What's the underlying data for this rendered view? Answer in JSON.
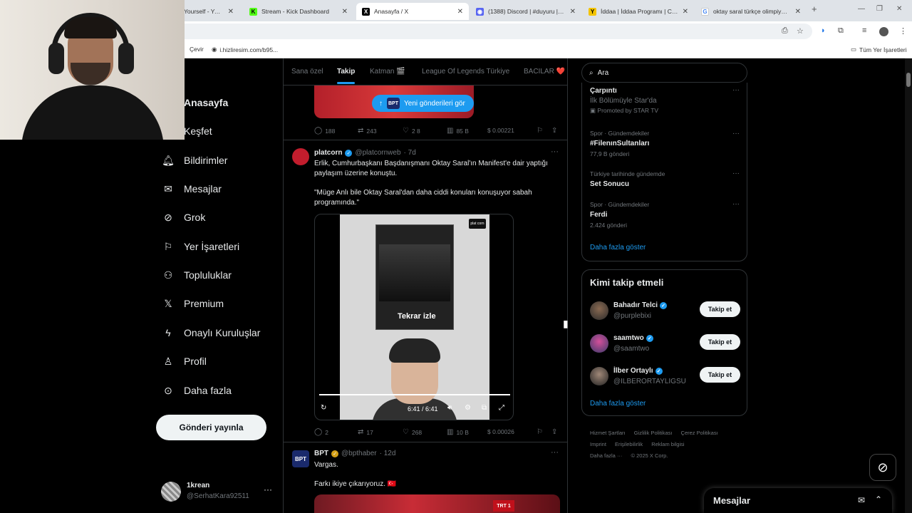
{
  "browser": {
    "tabs": [
      {
        "title": "Yourself - YouTu",
        "icon": "youtube-icon",
        "color": "#ff0000"
      },
      {
        "title": "Stream - Kick Dashboard",
        "icon": "kick-icon",
        "color": "#53fc18"
      },
      {
        "title": "Anasayfa / X",
        "icon": "x-icon",
        "color": "#000000"
      },
      {
        "title": "(1388) Discord | #duyuru | krea",
        "icon": "discord-icon",
        "color": "#5865f2"
      },
      {
        "title": "İddaa | İddaa Programı | Canlı",
        "icon": "iddaa-icon",
        "color": "#f4c400"
      },
      {
        "title": "oktay saral türkçe olimpiyatlan",
        "icon": "google-icon",
        "color": "#4285f4"
      }
    ],
    "bookmarks": {
      "translate": "Çevir",
      "link": "i.hizliresim.com/b95...",
      "all": "Tüm Yer İşaretleri"
    }
  },
  "nav": {
    "items": [
      {
        "label": "Anasayfa",
        "icon": "home-icon"
      },
      {
        "label": "Keşfet",
        "icon": "search-icon"
      },
      {
        "label": "Bildirimler",
        "icon": "bell-icon"
      },
      {
        "label": "Mesajlar",
        "icon": "mail-icon"
      },
      {
        "label": "Grok",
        "icon": "grok-icon"
      },
      {
        "label": "Yer İşaretleri",
        "icon": "bookmark-icon"
      },
      {
        "label": "Topluluklar",
        "icon": "communities-icon"
      },
      {
        "label": "Premium",
        "icon": "x-logo-icon"
      },
      {
        "label": "Onaylı Kuruluşlar",
        "icon": "lightning-icon"
      },
      {
        "label": "Profil",
        "icon": "person-icon"
      },
      {
        "label": "Daha fazla",
        "icon": "more-circle-icon"
      }
    ],
    "post_button": "Gönderi yayınla",
    "account": {
      "name": "1krean",
      "handle": "@SerhatKara92511"
    }
  },
  "feed": {
    "tabs": [
      "Sana özel",
      "Takip",
      "Katman 🎬",
      "League Of Legends Türkiye",
      "BACILAR ❤️"
    ],
    "active_tab": "Takip",
    "new_posts": "Yeni gönderileri gör",
    "new_posts_badge": "BPT",
    "first_actions": {
      "replies": "188",
      "reposts": "243",
      "likes": "2 8",
      "views": "85 B",
      "tips": "$ 0.00221"
    },
    "tweet1": {
      "name": "platcorn",
      "handle": "@platcornweb",
      "time": "· 7d",
      "text1": "Erlik, Cumhurbaşkanı Başdanışmanı Oktay Saral'ın Manifest'e dair yaptığı paylaşım üzerine konuştu.",
      "text2": "\"Müge Anlı bile Oktay Saral'dan daha ciddi konuları konuşuyor sabah programında.\"",
      "video": {
        "replay": "Tekrar izle",
        "time": "6:41 / 6:41",
        "logo": "plat corn"
      },
      "actions": {
        "replies": "2",
        "reposts": "17",
        "likes": "268",
        "views": "10 B",
        "tips": "$ 0.00026"
      }
    },
    "tweet2": {
      "name": "BPT",
      "handle": "@bpthaber",
      "time": "· 12d",
      "text1": "Vargas.",
      "text2": "Farkı ikiye çıkarıyoruz. 🇹🇷",
      "avatar_text": "BPT",
      "media_badge": "TRT 1"
    }
  },
  "right": {
    "search_placeholder": "Ara",
    "trends": [
      {
        "title": "Çarpıntı",
        "sub": "İlk Bölümüyle Star'da",
        "meta": "Promoted by STAR TV"
      },
      {
        "context": "Spor · Gündemdekiler",
        "title": "#FilenınSultanları",
        "meta": "77,9 B gönderi"
      },
      {
        "context": "Türkiye tarihinde gündemde",
        "title": "Set Sonucu"
      },
      {
        "context": "Spor · Gündemdekiler",
        "title": "Ferdi",
        "meta": "2.424 gönderi"
      }
    ],
    "trends_show_more": "Daha fazla göster",
    "who_title": "Kimi takip etmeli",
    "who": [
      {
        "name": "Bahadır Telci",
        "handle": "@purplebixi",
        "button": "Takip et"
      },
      {
        "name": "saamtwo",
        "handle": "@saamtwo",
        "button": "Takip et"
      },
      {
        "name": "İlber Ortaylı",
        "handle": "@ILBERORTAYLIGSU",
        "button": "Takip et"
      }
    ],
    "who_show_more": "Daha fazla göster",
    "footer": [
      "Hizmet Şartları",
      "Gizlilik Politikası",
      "Çerez Politikası",
      "Imprint",
      "Erişilebilirlik",
      "Reklam bilgisi",
      "Daha fazla ···",
      "© 2025 X Corp."
    ]
  },
  "dock": {
    "messages": "Mesajlar"
  }
}
